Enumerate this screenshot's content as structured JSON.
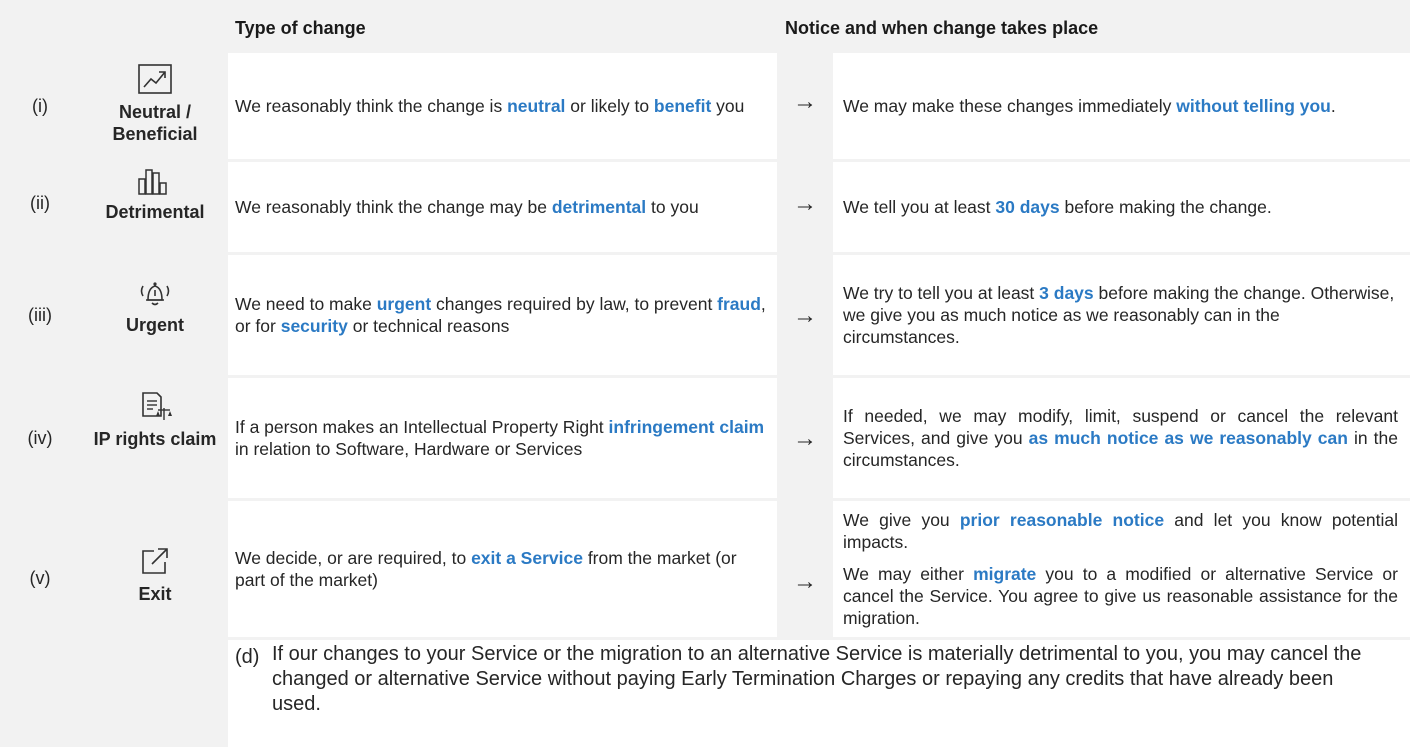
{
  "headers": {
    "type_of_change": "Type of change",
    "notice": "Notice and when change takes place"
  },
  "arrow": "→",
  "rows": [
    {
      "num": "(i)",
      "icon": "trend-chart-icon",
      "label": "Neutral / Beneficial",
      "desc": [
        "We reasonably think the change is ",
        "neutral",
        " or likely to ",
        "benefit",
        " you"
      ],
      "notice": [
        "We may make these changes immediately ",
        "without telling you",
        "."
      ]
    },
    {
      "num": "(ii)",
      "icon": "bar-chart-icon",
      "label": "Detrimental",
      "desc": [
        "We reasonably think the change may be ",
        "detrimental",
        " to you"
      ],
      "notice": [
        "We tell you at least ",
        "30 days",
        " before making the change."
      ]
    },
    {
      "num": "(iii)",
      "icon": "alarm-bell-icon",
      "label": "Urgent",
      "desc": [
        "We need to make ",
        "urgent",
        " changes required by law, to prevent ",
        "fraud",
        ", or for ",
        "security",
        " or technical reasons"
      ],
      "notice": [
        "We try to tell you at least ",
        "3 days",
        " before making the change. Otherwise, we give you as much notice as we reasonably can in the circumstances."
      ]
    },
    {
      "num": "(iv)",
      "icon": "document-scales-icon",
      "label": "IP rights claim",
      "desc": [
        "If a person makes an Intellectual Property Right ",
        "infringement claim",
        " in relation to Software, Hardware or Services"
      ],
      "notice": [
        "If needed, we may modify, limit, suspend or cancel the relevant Services, and give you ",
        "as much notice as we reasonably can",
        " in the circumstances."
      ]
    },
    {
      "num": "(v)",
      "icon": "exit-arrow-icon",
      "label": "Exit",
      "desc": [
        "We decide, or are required, to ",
        "exit a Service",
        " from the market (or part of the market)"
      ],
      "notice_p1": [
        "We give you ",
        "prior reasonable notice",
        " and let you know potential impacts."
      ],
      "notice_p2": [
        "We may either ",
        "migrate",
        " you to a modified or alternative Service or cancel the Service. You agree to give us reasonable assistance for the migration."
      ]
    }
  ],
  "footnote": {
    "label": "(d)",
    "text": "If our changes to your Service or the migration to an alternative Service is materially detrimental to you, you may cancel the changed or alternative Service without paying Early Termination Charges or repaying any credits that have already been used."
  },
  "colors": {
    "highlight": "#2b7ac4",
    "background": "#f2f2f2",
    "cell": "#ffffff"
  }
}
